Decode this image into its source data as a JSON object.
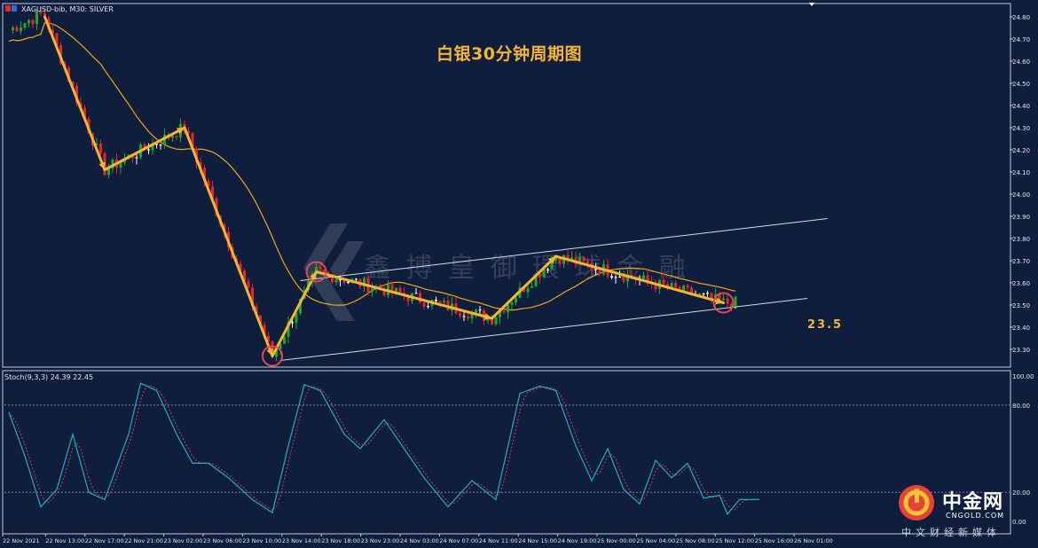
{
  "header": {
    "symbol_info": "XAGUSD-bib, M30:  SILVER",
    "stoch_label": "Stoch(9,3,3) 24.39 22.45"
  },
  "title": "白银30分钟周期图",
  "annotation": "23.5",
  "watermark": "鑫 搏 皇 御 環 球 金 融",
  "brand": {
    "name": "中金网",
    "url": "CNGOLD.COM",
    "slogan": "中文财经新媒体"
  },
  "colors": {
    "background": "#0f1e3d",
    "bull": "#1fa82a",
    "bear": "#e8262a",
    "doji": "#ffffff",
    "ma": "#f2a617",
    "trend_arrow": "#f3b533",
    "channel": "#d8dce4",
    "circle": "#e54950",
    "stoch_main": "#2aa8c8",
    "stoch_signal": "#d0404a",
    "grid_level": "#8a94a8"
  },
  "chart_data": [
    {
      "type": "candlestick",
      "title": "白银30分钟周期图",
      "ylim": [
        23.22,
        24.86
      ],
      "y_ticks": [
        "24.80",
        "24.70",
        "24.60",
        "24.50",
        "24.40",
        "24.30",
        "24.20",
        "24.10",
        "24.00",
        "23.90",
        "23.80",
        "23.70",
        "23.60",
        "23.50",
        "23.40",
        "23.30"
      ],
      "x_ticks": [
        "22 Nov 2021",
        "22 Nov 13:00",
        "22 Nov 17:00",
        "22 Nov 21:00",
        "23 Nov 02:00",
        "23 Nov 06:00",
        "23 Nov 10:00",
        "23 Nov 14:00",
        "23 Nov 18:00",
        "23 Nov 23:00",
        "24 Nov 03:00",
        "24 Nov 07:00",
        "24 Nov 11:00",
        "24 Nov 15:00",
        "24 Nov 19:00",
        "25 Nov 00:00",
        "25 Nov 04:00",
        "25 Nov 08:00",
        "25 Nov 12:00",
        "25 Nov 16:00",
        "26 Nov 01:00"
      ],
      "bars_total": 200,
      "trend_points": [
        [
          9,
          24.8
        ],
        [
          24,
          24.11
        ],
        [
          44,
          24.3
        ],
        [
          66,
          23.27
        ],
        [
          77,
          23.65
        ],
        [
          121,
          23.44
        ],
        [
          137,
          23.72
        ],
        [
          179,
          23.51
        ]
      ],
      "channel_upper": [
        [
          73,
          23.61
        ],
        [
          205,
          23.89
        ]
      ],
      "channel_lower": [
        [
          68,
          23.25
        ],
        [
          200,
          23.53
        ]
      ],
      "circles": [
        [
          66,
          23.27
        ],
        [
          77,
          23.65
        ],
        [
          179,
          23.51
        ]
      ],
      "annotation": "23.5"
    },
    {
      "type": "line",
      "title": "Stoch(9,3,3) 24.39 22.45",
      "ylim": [
        0,
        100
      ],
      "y_ticks": [
        "100.00",
        "80.00",
        "20.00",
        "0.00"
      ],
      "levels": [
        80,
        20
      ],
      "series_points": [
        [
          0,
          75
        ],
        [
          4,
          45
        ],
        [
          8,
          10
        ],
        [
          12,
          22
        ],
        [
          16,
          60
        ],
        [
          20,
          20
        ],
        [
          24,
          15
        ],
        [
          30,
          60
        ],
        [
          33,
          95
        ],
        [
          37,
          90
        ],
        [
          42,
          60
        ],
        [
          46,
          40
        ],
        [
          50,
          40
        ],
        [
          55,
          30
        ],
        [
          61,
          15
        ],
        [
          66,
          6
        ],
        [
          70,
          52
        ],
        [
          74,
          94
        ],
        [
          78,
          90
        ],
        [
          84,
          60
        ],
        [
          88,
          50
        ],
        [
          94,
          70
        ],
        [
          98,
          54
        ],
        [
          104,
          30
        ],
        [
          110,
          10
        ],
        [
          116,
          28
        ],
        [
          122,
          15
        ],
        [
          128,
          88
        ],
        [
          133,
          93
        ],
        [
          137,
          90
        ],
        [
          142,
          52
        ],
        [
          146,
          28
        ],
        [
          150,
          50
        ],
        [
          154,
          22
        ],
        [
          158,
          12
        ],
        [
          162,
          42
        ],
        [
          166,
          30
        ],
        [
          170,
          40
        ],
        [
          174,
          16
        ],
        [
          178,
          18
        ],
        [
          180,
          5
        ],
        [
          183,
          15
        ],
        [
          188,
          15
        ]
      ]
    }
  ]
}
